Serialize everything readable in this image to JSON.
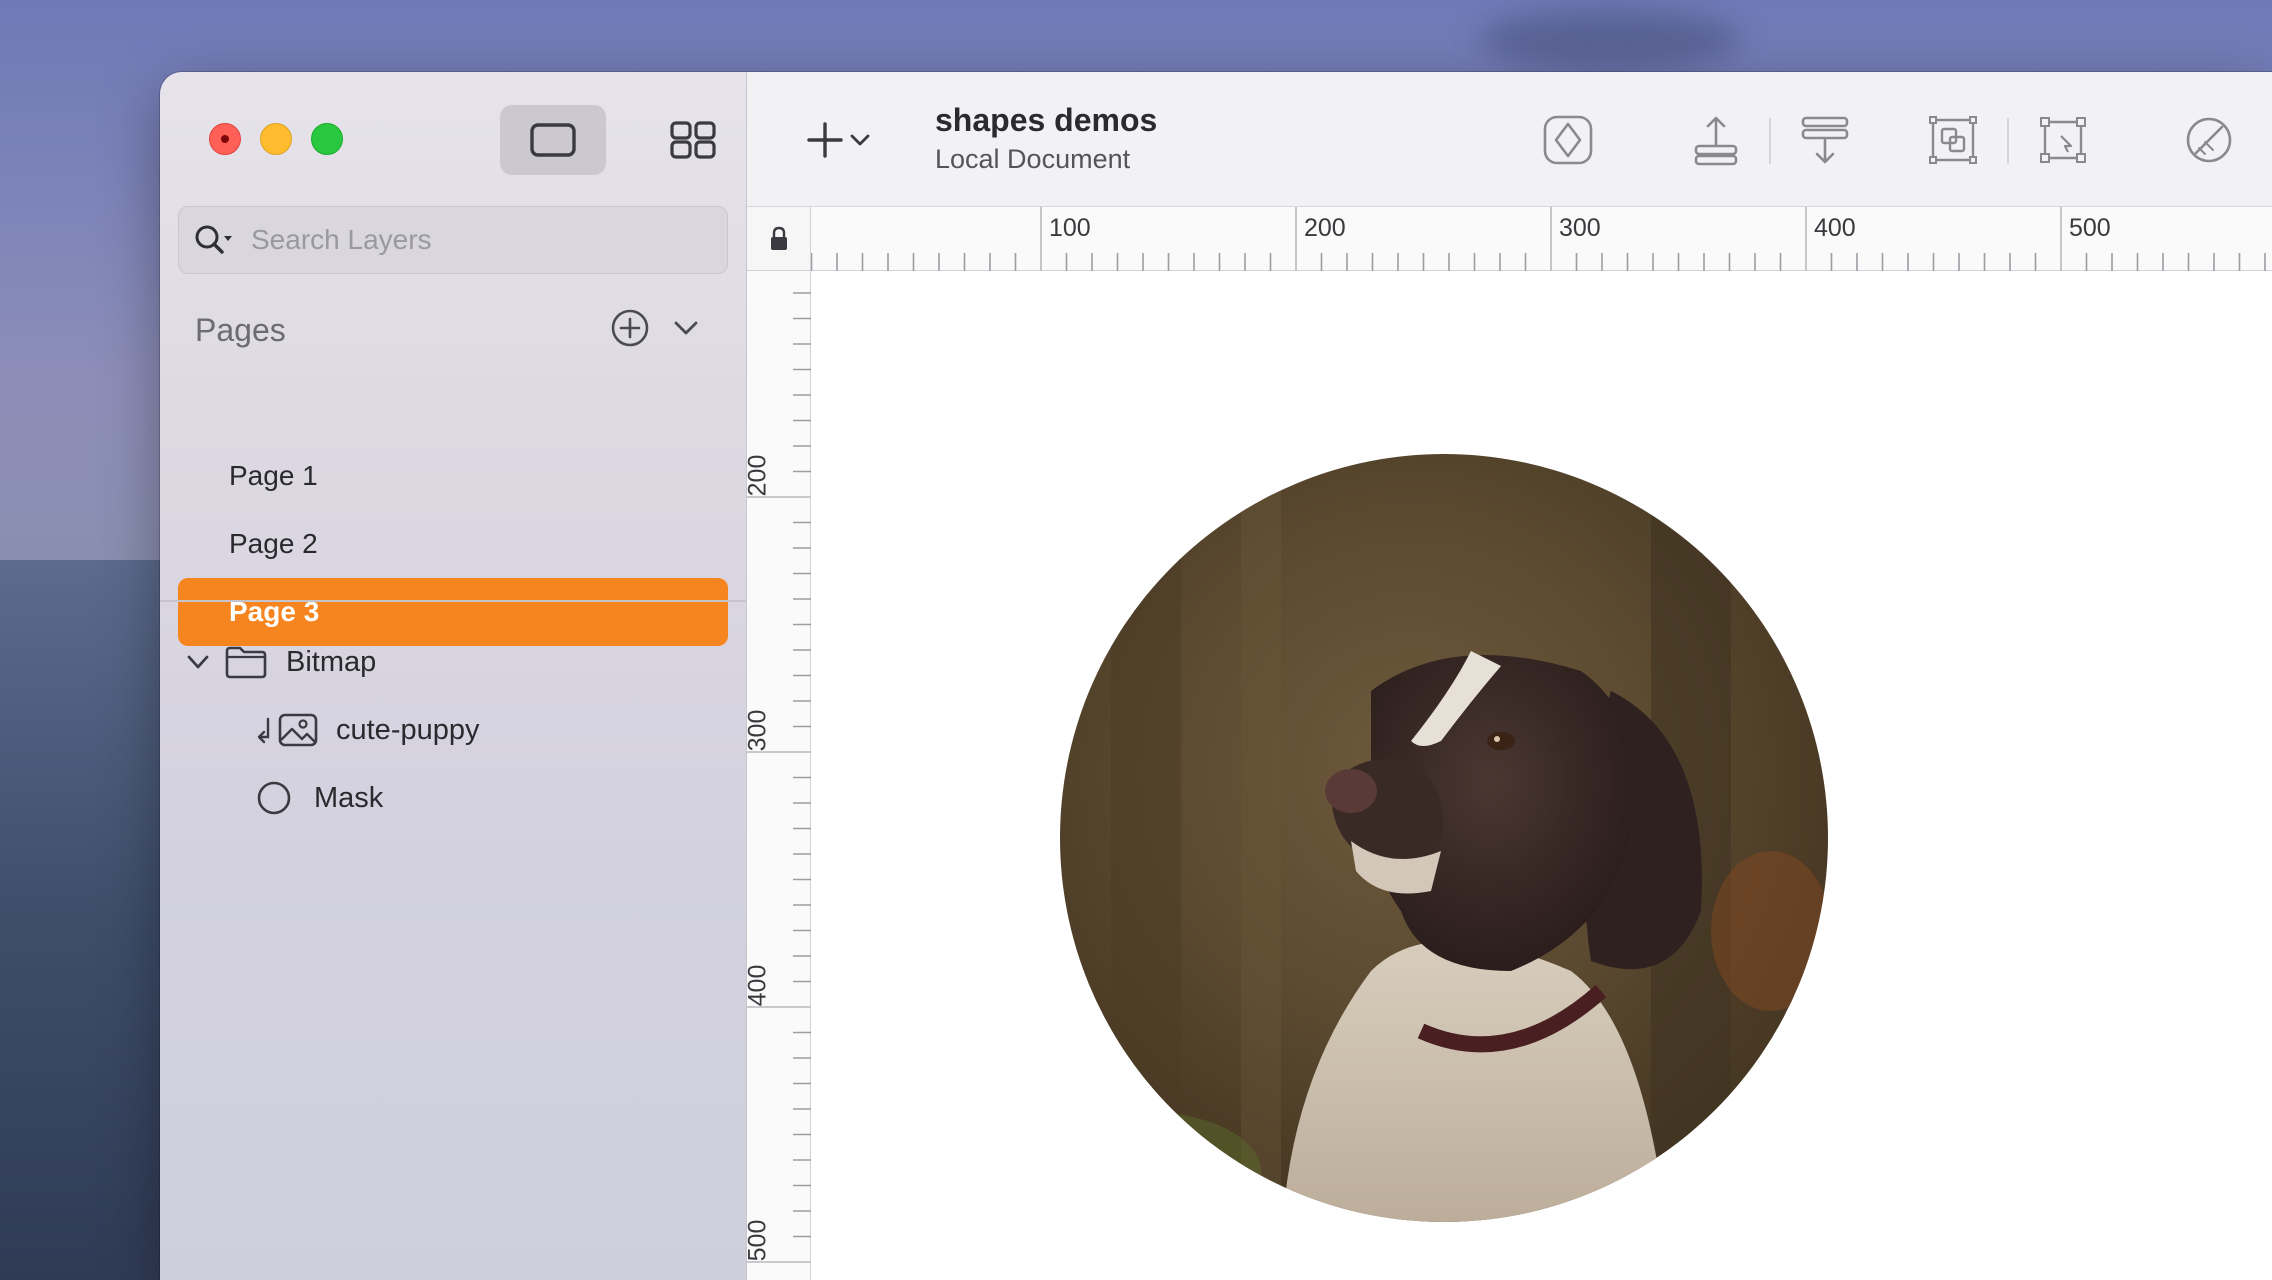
{
  "window": {
    "controls": [
      "close",
      "minimize",
      "maximize"
    ]
  },
  "sidebar": {
    "view_toggles": [
      {
        "name": "canvas-view-icon",
        "selected": true
      },
      {
        "name": "grid-view-icon",
        "selected": false
      }
    ],
    "search": {
      "placeholder": "Search Layers",
      "value": ""
    },
    "pages": {
      "header": "Pages",
      "items": [
        {
          "label": "Page 1",
          "selected": false
        },
        {
          "label": "Page 2",
          "selected": false
        },
        {
          "label": "Page 3",
          "selected": true
        }
      ]
    },
    "layers": {
      "group": {
        "label": "Bitmap",
        "icon": "folder-icon",
        "expanded": true
      },
      "children": [
        {
          "label": "cute-puppy",
          "icon": "image-icon",
          "masked": true
        },
        {
          "label": "Mask",
          "icon": "circle-icon"
        }
      ]
    }
  },
  "toolbar": {
    "document_title": "shapes demos",
    "document_subtitle": "Local Document",
    "buttons": [
      "add-icon",
      "create-symbol-icon",
      "move-forward-icon",
      "move-backward-icon",
      "group-icon",
      "edit-shape-icon",
      "mask-icon",
      "resize-icon"
    ]
  },
  "rulers": {
    "top_labels": [
      "100",
      "200",
      "300",
      "400",
      "500"
    ],
    "left_labels": [
      "200",
      "300",
      "400",
      "500"
    ]
  },
  "canvas": {
    "artboard_content": "circular masked photo of a spaniel",
    "accent": "#f6851f"
  }
}
